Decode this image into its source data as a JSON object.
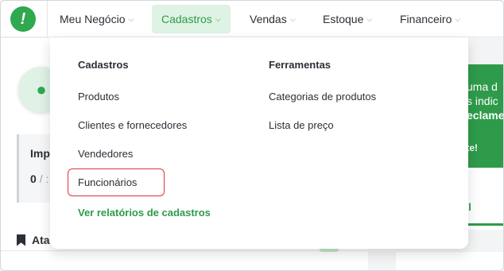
{
  "nav": {
    "logo_glyph": "!",
    "items": [
      {
        "label": "Meu Negócio"
      },
      {
        "label": "Cadastros"
      },
      {
        "label": "Vendas"
      },
      {
        "label": "Estoque"
      },
      {
        "label": "Financeiro"
      }
    ],
    "chevron": "⌵",
    "active_index": 1
  },
  "dropdown": {
    "cadastros_heading": "Cadastros",
    "ferramentas_heading": "Ferramentas",
    "cadastros_items": [
      "Produtos",
      "Clientes e fornecedores",
      "Vendedores",
      "Funcionários"
    ],
    "ferramentas_items": [
      "Categorias de produtos",
      "Lista de preço"
    ],
    "report_link": "Ver relatórios de cadastros"
  },
  "background": {
    "import_title": "Imp",
    "import_count": "0",
    "import_sep": "/ :",
    "atalhos": "Ata",
    "promo_line1": "uma d",
    "promo_line2": "s indic",
    "promo_line3": "eclame",
    "promo_cta": "gente!",
    "tab_label": "al"
  },
  "colors": {
    "brand_green": "#2e9b4a",
    "active_bg": "#def3e3",
    "highlight_red": "#d9353b"
  }
}
